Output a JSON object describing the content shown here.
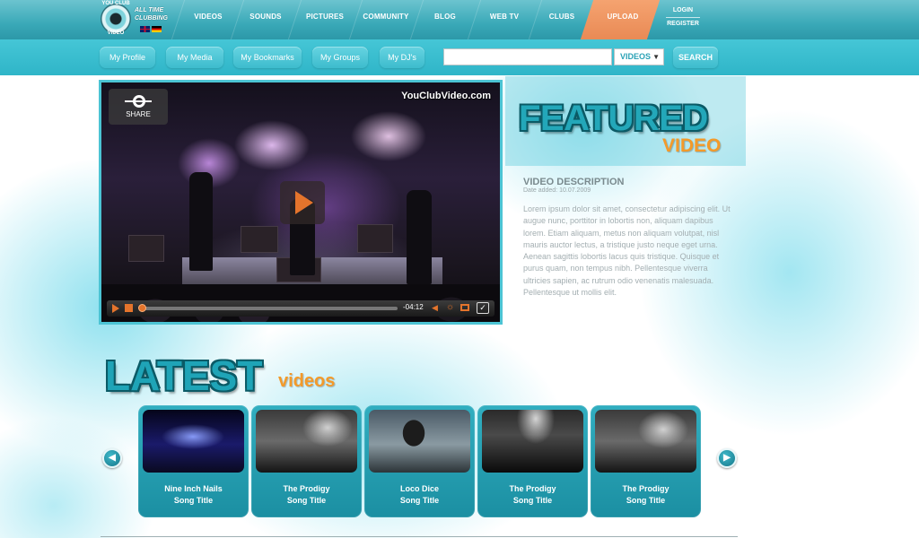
{
  "brand": {
    "logo_top": "YOU CLUB",
    "logo_bottom": "VIDEO",
    "tagline_line1": "ALL TIME",
    "tagline_line2": "CLUBBING"
  },
  "nav": {
    "items": [
      {
        "label": "VIDEOS"
      },
      {
        "label": "SOUNDS"
      },
      {
        "label": "PICTURES"
      },
      {
        "label": "COMMUNITY"
      },
      {
        "label": "BLOG"
      },
      {
        "label": "WEB TV"
      },
      {
        "label": "CLUBS"
      },
      {
        "label": "UPLOAD"
      }
    ],
    "login": "LOGIN",
    "register": "REGISTER"
  },
  "subnav": {
    "items": [
      {
        "label": "My Profile"
      },
      {
        "label": "My Media"
      },
      {
        "label": "My Bookmarks"
      },
      {
        "label": "My Groups"
      },
      {
        "label": "My DJ's"
      }
    ],
    "search_value": "",
    "search_category": "VIDEOS",
    "search_button": "SEARCH"
  },
  "player": {
    "share_label": "SHARE",
    "watermark": "YouClubVideo.com",
    "time": "-04:12"
  },
  "featured": {
    "title": "FEATURED",
    "subtitle": "VIDEO",
    "desc_title": "VIDEO DESCRIPTION",
    "desc_date": "Date added: 10.07.2009",
    "desc_body": "Lorem ipsum dolor sit amet, consectetur adipiscing elit. Ut augue nunc, porttitor in lobortis non, aliquam dapibus lorem. Etiam aliquam, metus non aliquam volutpat, nisl mauris auctor lectus, a tristique justo neque eget urna. Aenean sagittis lobortis lacus quis tristique. Quisque et purus quam, non tempus nibh. Pellentesque viverra ultricies sapien, ac rutrum odio venenatis malesuada. Pellentesque ut mollis elit."
  },
  "latest": {
    "title": "LATEST",
    "subtitle": "videos",
    "cards": [
      {
        "artist": "Nine Inch Nails",
        "song": "Song Title"
      },
      {
        "artist": "The Prodigy",
        "song": "Song Title"
      },
      {
        "artist": "Loco Dice",
        "song": "Song Title"
      },
      {
        "artist": "The Prodigy",
        "song": "Song Title"
      },
      {
        "artist": "The Prodigy",
        "song": "Song Title"
      }
    ]
  },
  "colors": {
    "accent": "#31aec0",
    "orange": "#f39a2a",
    "upload_tab": "#e98a55"
  }
}
